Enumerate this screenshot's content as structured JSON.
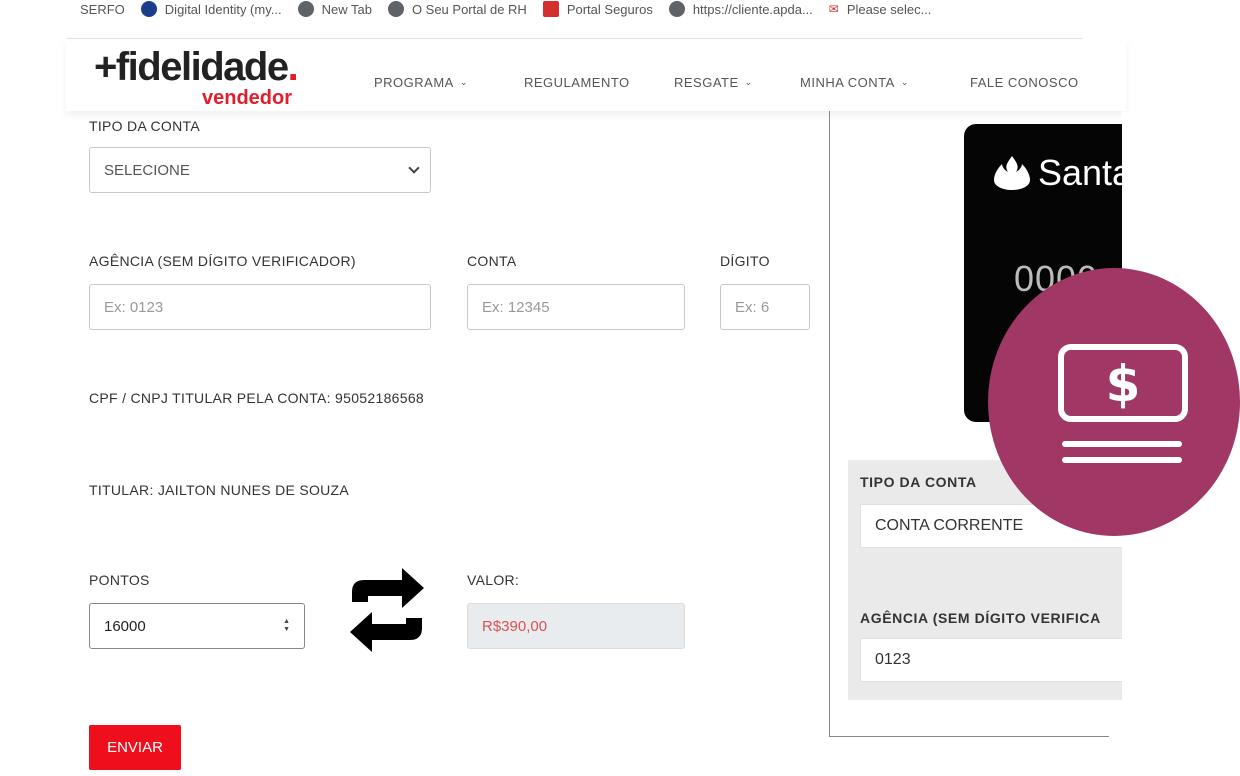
{
  "bookmarks": [
    {
      "label": "SERFO",
      "icon": "bookmark-icon"
    },
    {
      "label": "Digital Identity (my...",
      "icon": "globe-icon"
    },
    {
      "label": "New Tab",
      "icon": "globe-icon"
    },
    {
      "label": "O Seu Portal de RH",
      "icon": "globe-icon"
    },
    {
      "label": "Portal Seguros",
      "icon": "portal-icon"
    },
    {
      "label": "https://cliente.apda...",
      "icon": "globe-icon"
    },
    {
      "label": "Please selec...",
      "icon": "mail-icon"
    }
  ],
  "brand": {
    "logo_main": "+fidelidade",
    "logo_dot": ".",
    "logo_sub": "vendedor",
    "accent_color": "#e01e2d"
  },
  "nav": [
    {
      "label": "PROGRAMA",
      "dropdown": true
    },
    {
      "label": "REGULAMENTO",
      "dropdown": false
    },
    {
      "label": "RESGATE",
      "dropdown": true
    },
    {
      "label": "MINHA CONTA",
      "dropdown": true
    },
    {
      "label": "FALE CONOSCO",
      "dropdown": false
    }
  ],
  "form": {
    "account_type_label": "TIPO DA CONTA",
    "account_type_value": "SELECIONE",
    "agency_label": "AGÊNCIA (SEM DÍGITO VERIFICADOR)",
    "agency_placeholder": "Ex: 0123",
    "account_label": "CONTA",
    "account_placeholder": "Ex: 12345",
    "digit_label": "DÍGITO",
    "digit_placeholder": "Ex: 6",
    "cpf_text": "CPF / CNPJ TITULAR PELA CONTA: 95052186568",
    "holder_text": "TITULAR: JAILTON NUNES DE SOUZA",
    "points_label": "PONTOS",
    "points_value": "16000",
    "value_label": "VALOR:",
    "value_value": "R$390,00",
    "submit_label": "ENVIAR"
  },
  "preview": {
    "card_brand": "Santa",
    "card_number": "0000",
    "account_type_label": "TIPO DA CONTA",
    "account_type_value": "CONTA CORRENTE",
    "agency_label": "AGÊNCIA (SEM DÍGITO VERIFICA",
    "agency_value": "0123"
  },
  "badge": {
    "icon": "money-transfer-icon",
    "color": "#a03764"
  }
}
